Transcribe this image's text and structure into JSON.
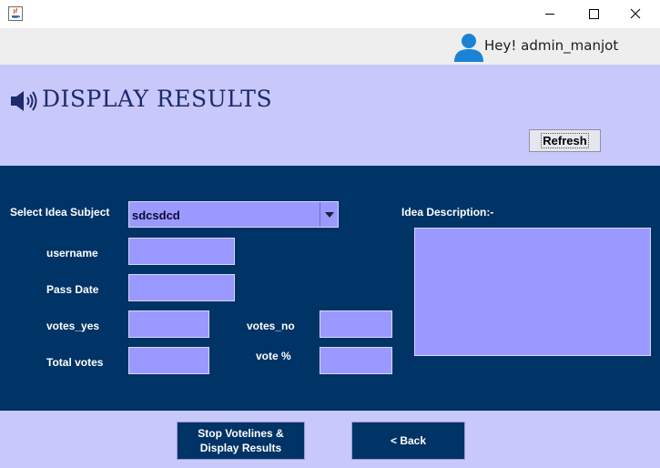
{
  "window": {
    "icons": {
      "app": "java-icon",
      "minimize": "minimize-icon",
      "maximize": "maximize-icon",
      "close": "close-icon"
    }
  },
  "header": {
    "greeting": "Hey! admin_manjot",
    "user_icon": "user-icon"
  },
  "title": {
    "text": "DISPLAY RESULTS",
    "icon": "speaker-icon"
  },
  "toolbar": {
    "refresh_label": "Refresh"
  },
  "form": {
    "subject_label": "Select Idea Subject",
    "subject_value": "sdcsdcd",
    "description_label": "Idea Description:-",
    "username_label": "username",
    "pass_date_label": "Pass Date",
    "votes_yes_label": "votes_yes",
    "votes_no_label": "votes_no",
    "total_votes_label": "Total votes",
    "vote_percent_label": "vote %",
    "username_value": "",
    "pass_date_value": "",
    "votes_yes_value": "",
    "votes_no_value": "",
    "total_votes_value": "",
    "vote_percent_value": "",
    "description_value": ""
  },
  "actions": {
    "stop_label_line1": "Stop Votelines &",
    "stop_label_line2": "Display Results",
    "back_label": "< Back"
  },
  "colors": {
    "header_bg": "#eeeeee",
    "panel_lavender": "#c8c8fb",
    "panel_navy": "#003366",
    "field_fill": "#9a99ff",
    "title_text": "#1d2a6b"
  }
}
